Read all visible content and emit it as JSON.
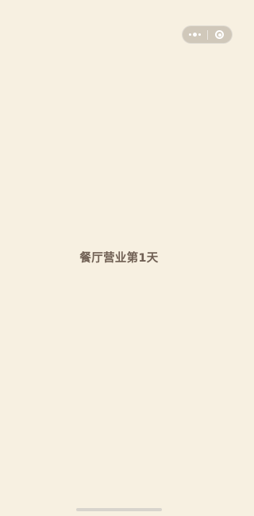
{
  "screen": {
    "background_color": "#f7f0e1",
    "title": "餐厅营业第1天",
    "title_color": "#6f5f53"
  },
  "capsule": {
    "more_icon": "more-dots-icon",
    "close_icon": "target-close-icon"
  }
}
